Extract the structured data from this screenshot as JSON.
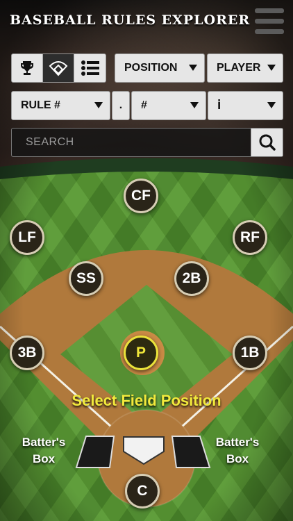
{
  "header": {
    "title": "BASEBALL RULES EXPLORER"
  },
  "toolbar": {
    "modes": [
      {
        "icon": "trophy-icon"
      },
      {
        "icon": "field-icon"
      },
      {
        "icon": "list-icon"
      }
    ],
    "position_dropdown": "POSITION",
    "player_dropdown": "PLAYER",
    "rule_dropdown": "RULE #",
    "separator": ".",
    "number_dropdown": "#",
    "info_dropdown": "i"
  },
  "search": {
    "placeholder": "SEARCH"
  },
  "positions": {
    "cf": "CF",
    "lf": "LF",
    "rf": "RF",
    "ss": "SS",
    "second": "2B",
    "third": "3B",
    "pitcher": "P",
    "first": "1B",
    "catcher": "C"
  },
  "prompt": "Select Field Position",
  "batters_box_left": "Batter's Box",
  "batters_box_right": "Batter's Box",
  "colors": {
    "accent_yellow": "#f2ea3c",
    "grass": "#4e8a2c",
    "dirt": "#c98a45"
  }
}
